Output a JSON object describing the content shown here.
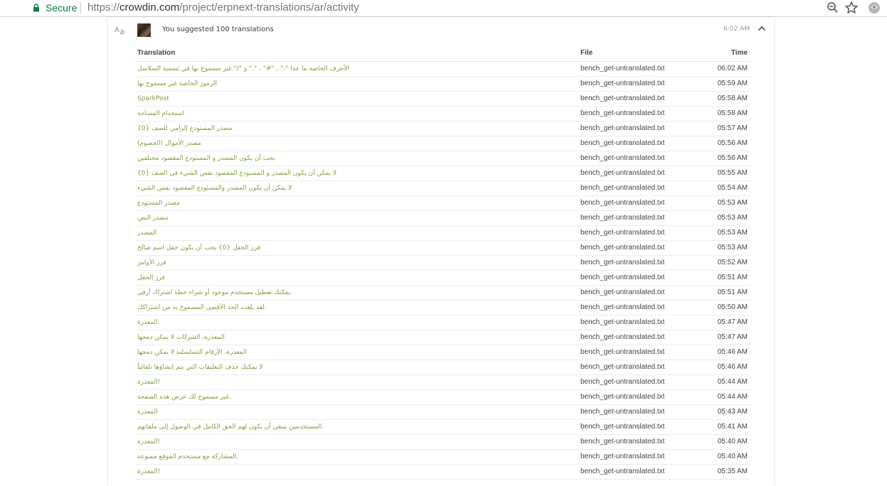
{
  "browser": {
    "secure_label": "Secure",
    "url_scheme": "https://",
    "url_host": "crowdin.com",
    "url_path": "/project/erpnext-translations/ar/activity",
    "security_color": "#0b8043"
  },
  "event": {
    "icon": "translate-icon",
    "text": "You suggested 100 translations",
    "time": "6:02 AM",
    "collapse_icon": "chevron-up-icon"
  },
  "table": {
    "headers": {
      "translation": "Translation",
      "file": "File",
      "time": "Time"
    },
    "accent_color": "#7fa23b",
    "rows": [
      {
        "translation": "الأحرف الخاصة ما عدا \"-\" ، \"#\" ، \".\" و \"/\" غير مسموح بها في تسمية السلاسل",
        "file": "bench_get-untranslated.txt",
        "time": "06:02 AM"
      },
      {
        "translation": "الرموز الخاصة غير مسموح بها",
        "file": "bench_get-untranslated.txt",
        "time": "05:59 AM"
      },
      {
        "translation": "SparkPost",
        "file": "bench_get-untranslated.txt",
        "time": "05:58 AM"
      },
      {
        "translation": "استخدام المساحة",
        "file": "bench_get-untranslated.txt",
        "time": "05:58 AM"
      },
      {
        "translation": "مصدر المستودع إلزامي للصف {0}",
        "file": "bench_get-untranslated.txt",
        "time": "05:57 AM"
      },
      {
        "translation": "مصدر الأموال (الخصوم)",
        "file": "bench_get-untranslated.txt",
        "time": "05:56 AM"
      },
      {
        "translation": "يجب أن يكون المصدر و المستودع المقصود مختلفين",
        "file": "bench_get-untranslated.txt",
        "time": "05:56 AM"
      },
      {
        "translation": "لا يمكن أن يكون المصدر و المستودع المقصود نفس الشيء في الصف {0}",
        "file": "bench_get-untranslated.txt",
        "time": "05:55 AM"
      },
      {
        "translation": "لا يمكن أن يكون المصدر والمستودع المقصود نفس الشيء",
        "file": "bench_get-untranslated.txt",
        "time": "05:54 AM"
      },
      {
        "translation": "مصدر المستودع",
        "file": "bench_get-untranslated.txt",
        "time": "05:53 AM"
      },
      {
        "translation": "مصدر النص",
        "file": "bench_get-untranslated.txt",
        "time": "05:53 AM"
      },
      {
        "translation": "المصدر",
        "file": "bench_get-untranslated.txt",
        "time": "05:53 AM"
      },
      {
        "translation": "فرز الحقل {0} يجب أن يكون حقل اسم صالح",
        "file": "bench_get-untranslated.txt",
        "time": "05:53 AM"
      },
      {
        "translation": "فرز الأوامر",
        "file": "bench_get-untranslated.txt",
        "time": "05:52 AM"
      },
      {
        "translation": "فرز الحقل",
        "file": "bench_get-untranslated.txt",
        "time": "05:51 AM"
      },
      {
        "translation": "يمكنك تعطيل مستخدم موجود أو شراء خطة اشتراك أرقى.",
        "file": "bench_get-untranslated.txt",
        "time": "05:51 AM"
      },
      {
        "translation": "لقد بلغت الحد الأقصى المسموح به من اشتراكك.",
        "file": "bench_get-untranslated.txt",
        "time": "05:50 AM"
      },
      {
        "translation": "المعذرة.",
        "file": "bench_get-untranslated.txt",
        "time": "05:47 AM"
      },
      {
        "translation": "المعذرة، الشركات لا يمكن دمجها",
        "file": "bench_get-untranslated.txt",
        "time": "05:47 AM"
      },
      {
        "translation": "المعذرة، الأرقام التسلسلية لا يمكن دمجها",
        "file": "bench_get-untranslated.txt",
        "time": "05:46 AM"
      },
      {
        "translation": "لا يمكنك حذف التعليقات التي يتم إنشاؤها تلقائياً",
        "file": "bench_get-untranslated.txt",
        "time": "05:46 AM"
      },
      {
        "translation": "المعذرة!",
        "file": "bench_get-untranslated.txt",
        "time": "05:44 AM"
      },
      {
        "translation": "غير مسموح لك عرض هذه الصفحة.",
        "file": "bench_get-untranslated.txt",
        "time": "05:44 AM"
      },
      {
        "translation": "المعذرة",
        "file": "bench_get-untranslated.txt",
        "time": "05:43 AM"
      },
      {
        "translation": "المستخدمين ينبغي أن يكون لهم الحق الكامل في الوصول إلى ملفاتهم.",
        "file": "bench_get-untranslated.txt",
        "time": "05:41 AM"
      },
      {
        "translation": "المعذرة!",
        "file": "bench_get-untranslated.txt",
        "time": "05:40 AM"
      },
      {
        "translation": "المشاركة مع مستخدم الموقع ممنوعة.",
        "file": "bench_get-untranslated.txt",
        "time": "05:40 AM"
      },
      {
        "translation": "المعذرة!",
        "file": "bench_get-untranslated.txt",
        "time": "05:35 AM"
      }
    ]
  }
}
